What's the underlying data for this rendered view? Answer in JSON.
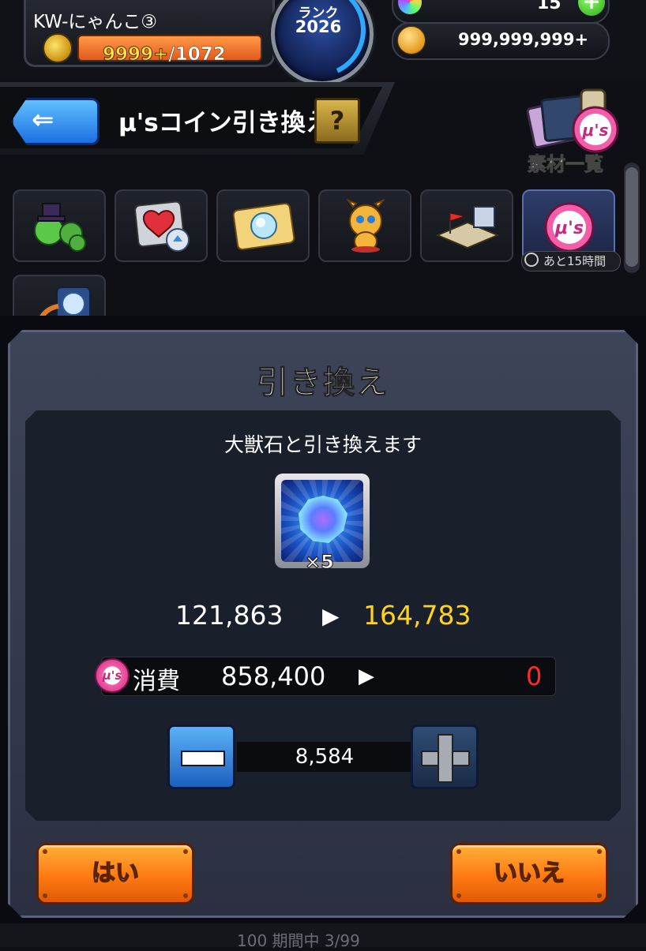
{
  "player": {
    "name": "KW-にゃんこ③",
    "stamina_current": "9999+",
    "stamina_max": "/1072"
  },
  "rank": {
    "label": "ランク",
    "value": "2026"
  },
  "currency": {
    "gems": "15",
    "gem_plus": "+",
    "coins": "999,999,999+"
  },
  "header": {
    "back_icon": "back-arrow",
    "title": "μ'sコイン引き換え",
    "help_label": "?"
  },
  "materials": {
    "label": "素材一覧"
  },
  "categories": [
    {
      "name": "clover-hat-item"
    },
    {
      "name": "heart-fruit-item"
    },
    {
      "name": "orb-ticket-item"
    },
    {
      "name": "dragon-character"
    },
    {
      "name": "stage-flag-item"
    },
    {
      "name": "mus-coin-item",
      "selected": true,
      "timer": "あと15時間"
    },
    {
      "name": "orb-exchange-item"
    }
  ],
  "modal": {
    "title": "引き換え",
    "message": "大獣石と引き換えます",
    "item": {
      "icon": "beast-stone-icon",
      "quantity": "×5"
    },
    "count_before": "121,863",
    "count_after": "164,783",
    "cost": {
      "coin_icon": "μ's",
      "label": "消費",
      "value": "858,400",
      "remaining": "0"
    },
    "stepper_value": "8,584",
    "yes_label": "はい",
    "no_label": "いいえ"
  },
  "bottom": {
    "text": "100  期間中  3/99"
  },
  "colors": {
    "accent_orange": "#ff7a12",
    "after_count": "#ffd21e",
    "remaining_red": "#ff2a2a",
    "back_blue": "#1d6fe0"
  }
}
